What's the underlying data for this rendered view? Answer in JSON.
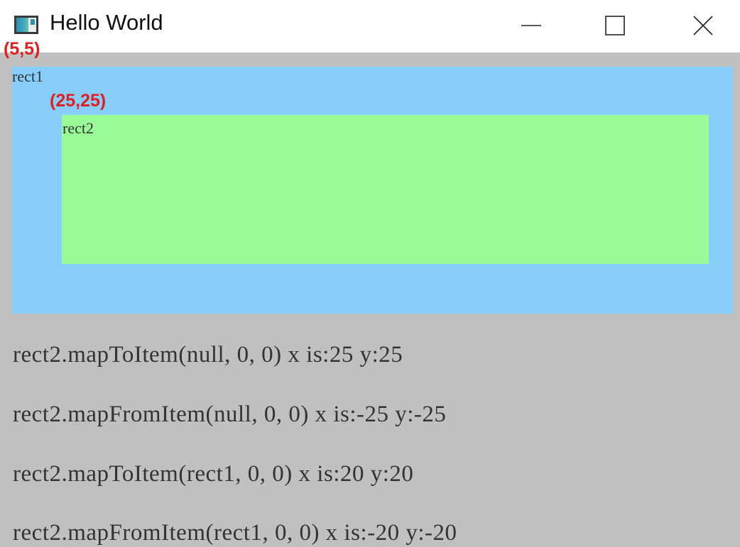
{
  "window": {
    "title": "Hello World"
  },
  "annotations": {
    "rect1_origin": "(5,5)",
    "rect2_origin": "(25,25)"
  },
  "rect1": {
    "label": "rect1",
    "color": "#87cefa"
  },
  "rect2": {
    "label": "rect2",
    "color": "#98fb98"
  },
  "results": [
    "rect2.mapToItem(null, 0, 0) x is:25 y:25",
    "rect2.mapFromItem(null, 0, 0) x is:-25 y:-25",
    "rect2.mapToItem(rect1, 0, 0) x is:20 y:20",
    "rect2.mapFromItem(rect1, 0, 0) x is:-20 y:-20"
  ],
  "icons": {
    "app": "app-icon",
    "minimize": "minimize-icon",
    "maximize": "maximize-icon",
    "close": "close-icon"
  },
  "colors": {
    "background": "#c0c0c0",
    "annotation": "#e02020"
  }
}
